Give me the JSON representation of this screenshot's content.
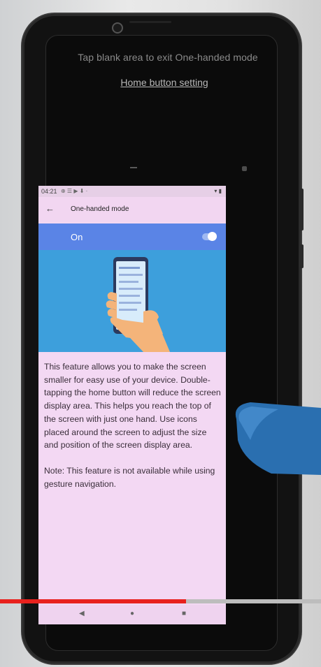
{
  "overlay": {
    "hint": "Tap blank area to exit One-handed mode",
    "home_button_setting": "Home button setting"
  },
  "mini_screen": {
    "status_bar": {
      "time": "04:21",
      "icons_left": "⊕ ☰ ▶ ⬇ ·",
      "icons_right": "▾ ▮"
    },
    "app_bar": {
      "back_icon": "back-arrow-icon",
      "title": "One-handed mode"
    },
    "switch": {
      "label": "On",
      "state": true
    },
    "illustration": "hand-holding-phone-illustration",
    "description": [
      "This feature allows you to make the screen smaller for easy use of your device. Double-tapping the home button will reduce the screen display area. This helps you reach the top of the screen with just one hand. Use icons placed around the screen to adjust the size and position of the screen display area.",
      "Note: This feature is not available while using gesture navigation."
    ],
    "nav_bar": {
      "back": "◀",
      "home": "●",
      "recent": "■"
    }
  },
  "video_progress": {
    "fraction": 0.58,
    "fill_color": "#e8211d",
    "track_color": "#bdbdbd"
  },
  "colors": {
    "switch_bar": "#5a84e6",
    "illustration_bg": "#3d9fdc",
    "screen_tint": "#f3d8f3"
  }
}
